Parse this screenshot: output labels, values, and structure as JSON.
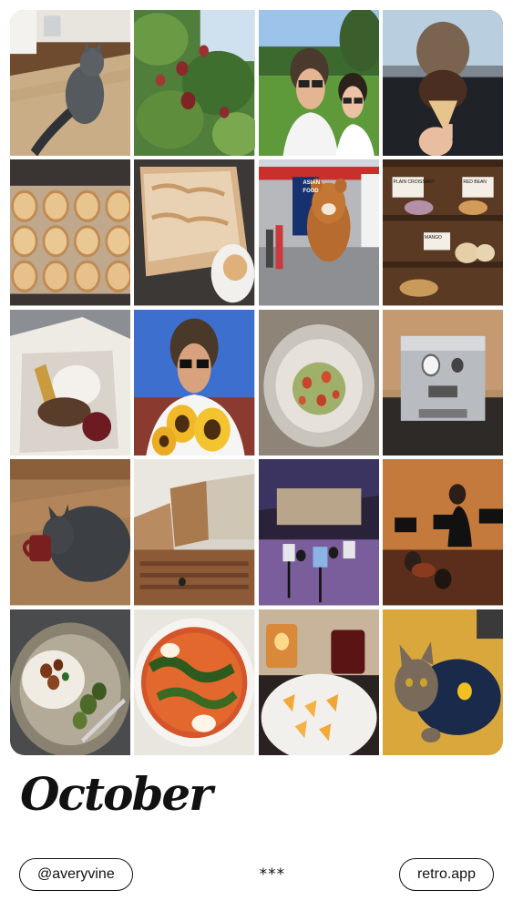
{
  "collage": {
    "month_title": "October",
    "rows": 5,
    "columns": 4,
    "photos": [
      {
        "subject": "gray cat on jute rug"
      },
      {
        "subject": "apple tree branches"
      },
      {
        "subject": "selfie in orchard"
      },
      {
        "subject": "chocolate ice cream cone"
      },
      {
        "subject": "tray of cinnamon rolls"
      },
      {
        "subject": "frosted cinnamon rolls"
      },
      {
        "subject": "bear mascot at festival"
      },
      {
        "subject": "bakery display shelves"
      },
      {
        "subject": "takeout box with bao"
      },
      {
        "subject": "selfie with sunflowers"
      },
      {
        "subject": "pasta plate"
      },
      {
        "subject": "espresso machine"
      },
      {
        "subject": "cat drinking from mug"
      },
      {
        "subject": "concert hall interior"
      },
      {
        "subject": "orchestra on stage"
      },
      {
        "subject": "orchestra musicians"
      },
      {
        "subject": "rice and brussels sprouts"
      },
      {
        "subject": "shakshuka with herbs"
      },
      {
        "subject": "candle and cheese platter"
      },
      {
        "subject": "cat in sweater"
      }
    ],
    "signage": {
      "festival_banner_1": "ASIAN",
      "festival_banner_2": "FOOD",
      "bakery_sign_1": "PLAIN CROISSANT",
      "bakery_sign_2": "RED BEAN",
      "bakery_sign_3": "MANGO"
    }
  },
  "footer": {
    "handle": "@averyvine",
    "separator": "***",
    "app_link": "retro.app"
  },
  "colors": {
    "background": "#ffffff",
    "text": "#111111",
    "pill_border": "#111111"
  }
}
